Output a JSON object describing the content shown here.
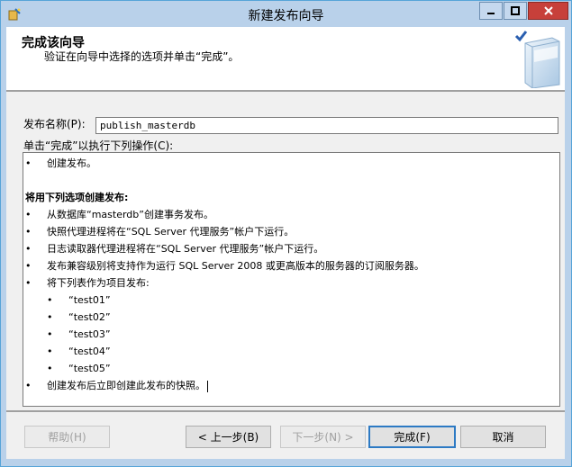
{
  "window": {
    "title": "新建发布向导",
    "controls": {
      "minimize": "—",
      "maximize": "□",
      "close": "✕"
    }
  },
  "header": {
    "title": "完成该向导",
    "subtitle": "验证在向导中选择的选项并单击“完成”。"
  },
  "form": {
    "publication_name_label": "发布名称(P):",
    "publication_name_value": "publish_masterdb",
    "actions_label": "单击“完成”以执行下列操作(C):"
  },
  "summary": {
    "bullet": "•",
    "create": "创建发布。",
    "options_heading": "将用下列选项创建发布:",
    "options": [
      "从数据库“masterdb”创建事务发布。",
      "快照代理进程将在“SQL Server 代理服务”帐户下运行。",
      "日志读取器代理进程将在“SQL Server 代理服务”帐户下运行。",
      "发布兼容级别将支持作为运行 SQL Server 2008 或更高版本的服务器的订阅服务器。",
      "将下列表作为项目发布:"
    ],
    "articles": [
      "“test01”",
      "“test02”",
      "“test03”",
      "“test04”",
      "“test05”"
    ],
    "snapshot": "创建发布后立即创建此发布的快照。"
  },
  "buttons": {
    "help": "帮助(H)",
    "back": "< 上一步(B)",
    "next": "下一步(N) >",
    "finish": "完成(F)",
    "cancel": "取消"
  },
  "colors": {
    "title_bar": "#b9d1ea",
    "close_button": "#c7403a",
    "default_button_border": "#2d7ac4"
  },
  "icons": {
    "app": "wizard-app-icon",
    "header_art": "books-checkmark-icon"
  }
}
